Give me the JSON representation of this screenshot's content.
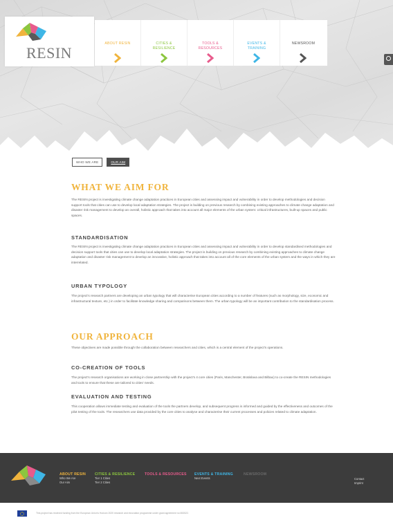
{
  "brand": {
    "name": "RESIN",
    "logo_colors": [
      "#f0b43d",
      "#8cc63f",
      "#e85b8c",
      "#3fb6e6",
      "#5a5a5a"
    ]
  },
  "nav": {
    "items": [
      {
        "label": "ABOUT RESIN",
        "color": "#f0b43d"
      },
      {
        "label": "CITIES & RESILIENCE",
        "color": "#8cc63f"
      },
      {
        "label": "TOOLS & RESOURCES",
        "color": "#e85b8c"
      },
      {
        "label": "EVENTS & TRAINING",
        "color": "#3fb6e6"
      },
      {
        "label": "NEWSROOM",
        "color": "#555555"
      }
    ]
  },
  "subnav": {
    "who_we_are": "WHO WE ARE",
    "our_aim": "OUR AIM"
  },
  "main": {
    "heading": "WHAT WE AIM FOR",
    "intro": "The RESIN project is investigating climate change adaptation practices in European cities and assessing impact and vulnerability in order to develop methodologies and decision support tools that cities can use to develop local adaptation strategies. The project is building on previous research by combining existing approaches to climate change adaptation and disaster risk management to develop an overall, holistic approach that takes into account all major elements of the urban system: critical infrastructures, built-up spaces and public spaces.",
    "standardisation_title": "STANDARDISATION",
    "standardisation_text": "The RESIN project is investigating climate change adaptation practices in European cities and assessing impact and vulnerability in order to develop standardised methodologies and decision support tools that cities can use to develop local adaptation strategies. The project is building on previous research by combining existing approaches to climate change adaptation and disaster risk management to develop an innovative, holistic approach that takes into account all of the core elements of the urban system and the ways in which they are interrelated.",
    "typology_title": "URBAN TYPOLOGY",
    "typology_text": "The project's research partners are developing an urban typology that will characterise European cities according to a number of features (such as morphology, size, economic and infrastructural texture, etc.) in order to facilitate knowledge sharing and comparisons between them. The urban typology will be an important contribution to the standardisation process.",
    "approach_heading": "OUR APPROACH",
    "approach_text": "These objectives are made possible through the collaboration between researchers and cities, which is a central element of the project's operations.",
    "cocreation_title": "CO-CREATION OF TOOLS",
    "cocreation_text": "The project's research organisations are working in close partnership with the project's 4 core cities (Paris, Manchester, Bratislava and Bilbao) to co-create the RESIN methodologies and tools to ensure that these are tailored to cities' needs.",
    "evaluation_title": "EVALUATION AND TESTING",
    "evaluation_text": "This cooperation allows immediate testing and evaluation of the tools the partners develop, and subsequent progress is informed and guided by the effectiveness and outcomes of the pilot testing of the tools. The researchers use data provided by the core cities to analyse and characterise their current processes and policies related to climate adaptation."
  },
  "footer": {
    "about": {
      "title": "ABOUT RESIN",
      "links": [
        "Who We Are",
        "Our Aim"
      ]
    },
    "cities": {
      "title": "CITIES & RESILIENCE",
      "links": [
        "Tier 1 Cities",
        "Tier 2 Cities"
      ]
    },
    "tools": {
      "title": "TOOLS & RESOURCES"
    },
    "events": {
      "title": "EVENTS & TRAINING",
      "links": [
        "Next Events"
      ]
    },
    "newsroom": {
      "title": "NEWSROOM"
    },
    "legal": [
      "Contact",
      "Imprint"
    ]
  },
  "funding_note": "This project has received funding from the European Union's Horizon 2020 research and innovation programme under grant agreement no 653522."
}
